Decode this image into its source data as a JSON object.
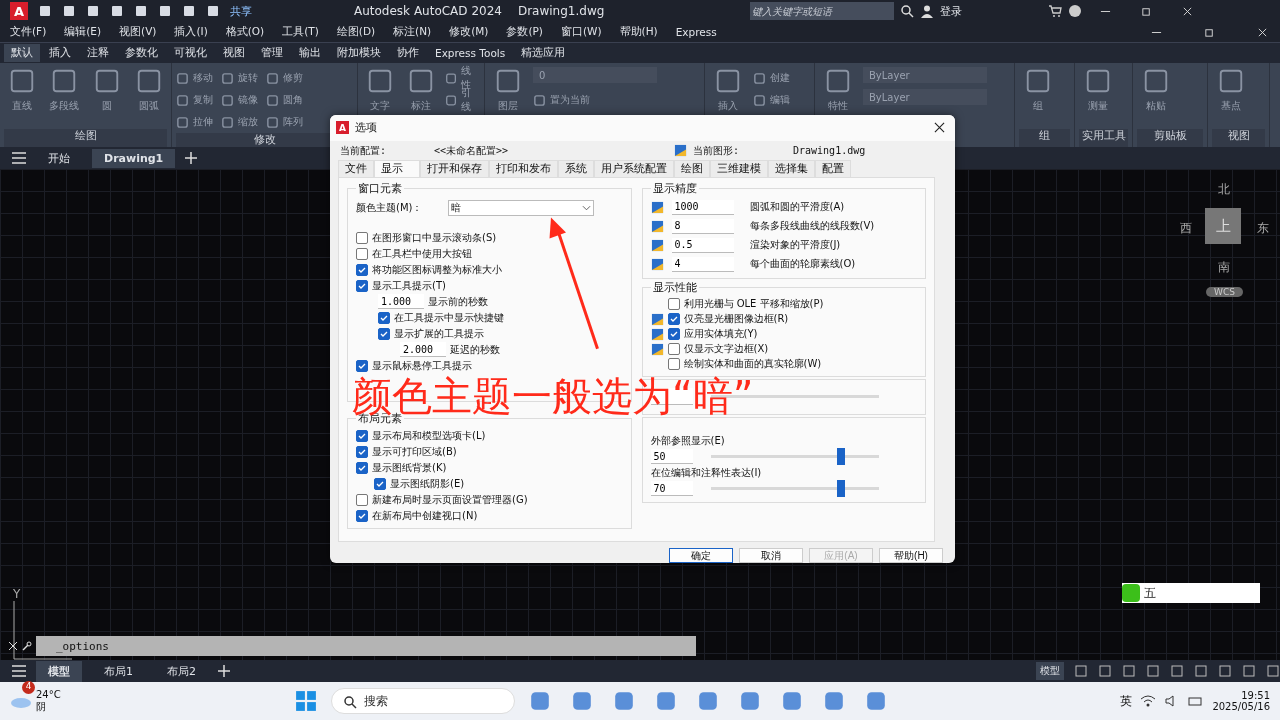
{
  "title_bar": {
    "logo_letter": "A",
    "share": "共享",
    "app_title": "Autodesk AutoCAD 2024",
    "file_name": "Drawing1.dwg",
    "search": {
      "placeholder": "键入关键字或短语"
    },
    "sign_in": "登录"
  },
  "menu_bar": [
    "文件(F)",
    "编辑(E)",
    "视图(V)",
    "插入(I)",
    "格式(O)",
    "工具(T)",
    "绘图(D)",
    "标注(N)",
    "修改(M)",
    "参数(P)",
    "窗口(W)",
    "帮助(H)",
    "Express"
  ],
  "ribbon": {
    "tabs": [
      {
        "label": "默认",
        "selected": true
      },
      {
        "label": "插入",
        "selected": false
      },
      {
        "label": "注释",
        "selected": false
      },
      {
        "label": "参数化",
        "selected": false
      },
      {
        "label": "可视化",
        "selected": false
      },
      {
        "label": "视图",
        "selected": false
      },
      {
        "label": "管理",
        "selected": false
      },
      {
        "label": "输出",
        "selected": false
      },
      {
        "label": "附加模块",
        "selected": false
      },
      {
        "label": "协作",
        "selected": false
      },
      {
        "label": "Express Tools",
        "selected": false
      },
      {
        "label": "精选应用",
        "selected": false
      }
    ],
    "panels": [
      {
        "title": "绘图",
        "tools": [
          {
            "kind": "large",
            "label": "直线"
          },
          {
            "kind": "large",
            "label": "多段线"
          },
          {
            "kind": "large",
            "label": "圆"
          },
          {
            "kind": "large",
            "label": "圆弧"
          }
        ]
      },
      {
        "title": "修改",
        "tools": [
          {
            "kind": "small",
            "label": "移动"
          },
          {
            "kind": "small",
            "label": "复制"
          },
          {
            "kind": "small",
            "label": "拉伸"
          },
          {
            "kind": "small",
            "label": "旋转"
          },
          {
            "kind": "small",
            "label": "镜像"
          },
          {
            "kind": "small",
            "label": "缩放"
          },
          {
            "kind": "small",
            "label": "修剪"
          },
          {
            "kind": "small",
            "label": "圆角"
          },
          {
            "kind": "small",
            "label": "阵列"
          }
        ]
      },
      {
        "tools": [
          {
            "kind": "large",
            "label": "文字"
          },
          {
            "kind": "large",
            "label": "标注"
          },
          {
            "kind": "small",
            "label": "线性"
          },
          {
            "kind": "small",
            "label": "引线"
          }
        ]
      },
      {
        "tools": [
          {
            "kind": "large",
            "label": "图层"
          },
          {
            "kind": "dropdown",
            "value": "0"
          },
          {
            "kind": "small",
            "label": "置为当前"
          }
        ]
      },
      {
        "tools": [
          {
            "kind": "large",
            "label": "插入"
          },
          {
            "kind": "small",
            "label": "创建"
          },
          {
            "kind": "small",
            "label": "编辑"
          }
        ]
      },
      {
        "tools": [
          {
            "kind": "large",
            "label": "特性"
          },
          {
            "kind": "dropdown",
            "value": "ByLayer"
          },
          {
            "kind": "dropdown",
            "value": "ByLayer"
          }
        ]
      },
      {
        "title": "组",
        "tools": [
          {
            "kind": "large",
            "label": "组"
          }
        ]
      },
      {
        "title": "实用工具",
        "tools": [
          {
            "kind": "large",
            "label": "测量"
          }
        ]
      },
      {
        "title": "剪贴板",
        "tools": [
          {
            "kind": "large",
            "label": "粘贴"
          }
        ]
      },
      {
        "title": "视图",
        "tools": [
          {
            "kind": "large",
            "label": "基点"
          }
        ]
      }
    ]
  },
  "doc_tabs": [
    {
      "label": "开始",
      "selected": false
    },
    {
      "label": "Drawing1",
      "selected": true
    }
  ],
  "viewcube": {
    "north": "北",
    "west": "西",
    "top": "上",
    "east": "东",
    "south": "南",
    "ucs": "WCS"
  },
  "ucs_axis": "Y",
  "command_line": {
    "value": "_options"
  },
  "ime_bar": {
    "mode": "五"
  },
  "layout_tabs": [
    {
      "label": "模型",
      "selected": true
    },
    {
      "label": "布局1",
      "selected": false
    },
    {
      "label": "布局2",
      "selected": false
    }
  ],
  "status_bar": {
    "space": "模型"
  },
  "dialog": {
    "logo_letter": "A",
    "title": "选项",
    "profile_label": "当前配置:",
    "profile": "<<未命名配置>>",
    "drawing_label": "当前图形:",
    "drawing": "Drawing1.dwg",
    "tabs": [
      {
        "label": "文件",
        "selected": false
      },
      {
        "label": "显示",
        "selected": true
      },
      {
        "label": "打开和保存",
        "selected": false
      },
      {
        "label": "打印和发布",
        "selected": false
      },
      {
        "label": "系统",
        "selected": false
      },
      {
        "label": "用户系统配置",
        "selected": false
      },
      {
        "label": "绘图",
        "selected": false
      },
      {
        "label": "三维建模",
        "selected": false
      },
      {
        "label": "选择集",
        "selected": false
      },
      {
        "label": "配置",
        "selected": false
      }
    ],
    "window_elements": {
      "title": "窗口元素",
      "theme_label": "颜色主题(M)：",
      "theme": "暗",
      "items": [
        {
          "kind": "checkbox",
          "label": "在图形窗口中显示滚动条(S)",
          "checked": false
        },
        {
          "kind": "checkbox",
          "label": "在工具栏中使用大按钮",
          "checked": false
        },
        {
          "kind": "checkbox",
          "label": "将功能区图标调整为标准大小",
          "checked": true
        },
        {
          "kind": "checkbox",
          "label": "显示工具提示(T)",
          "checked": true,
          "children": [
            {
              "kind": "number",
              "value": "1.000",
              "label": "显示前的秒数"
            },
            {
              "kind": "checkbox",
              "label": "在工具提示中显示快捷键",
              "checked": true
            },
            {
              "kind": "checkbox",
              "label": "显示扩展的工具提示",
              "checked": true,
              "children": [
                {
                  "kind": "number",
                  "value": "2.000",
                  "label": "延迟的秒数"
                }
              ]
            }
          ]
        },
        {
          "kind": "checkbox",
          "label": "显示鼠标悬停工具提示",
          "checked": true
        }
      ]
    },
    "layout_elements": {
      "title": "布局元素",
      "items": [
        {
          "kind": "checkbox",
          "label": "显示布局和模型选项卡(L)",
          "checked": true
        },
        {
          "kind": "checkbox",
          "label": "显示可打印区域(B)",
          "checked": true
        },
        {
          "kind": "checkbox",
          "label": "显示图纸背景(K)",
          "checked": true,
          "children": [
            {
              "kind": "checkbox",
              "label": "显示图纸阴影(E)",
              "checked": true
            }
          ]
        },
        {
          "kind": "checkbox",
          "label": "新建布局时显示页面设置管理器(G)",
          "checked": false
        },
        {
          "kind": "checkbox",
          "label": "在新布局中创建视口(N)",
          "checked": true
        }
      ]
    },
    "resolution": {
      "title": "显示精度",
      "rows": [
        {
          "value": "1000",
          "label": "圆弧和圆的平滑度(A)"
        },
        {
          "value": "8",
          "label": "每条多段线曲线的线段数(V)"
        },
        {
          "value": "0.5",
          "label": "渲染对象的平滑度(J)"
        },
        {
          "value": "4",
          "label": "每个曲面的轮廓素线(O)"
        }
      ]
    },
    "performance": {
      "title": "显示性能",
      "rows": [
        {
          "label": "利用光栅与 OLE 平移和缩放(P)",
          "checked": false,
          "drawing_icon": false
        },
        {
          "label": "仅亮显光栅图像边框(R)",
          "checked": true,
          "drawing_icon": true
        },
        {
          "label": "应用实体填充(Y)",
          "checked": true,
          "drawing_icon": true
        },
        {
          "label": "仅显示文字边框(X)",
          "checked": false,
          "drawing_icon": true
        },
        {
          "label": "绘制实体和曲面的真实轮廓(W)",
          "checked": false,
          "drawing_icon": false
        }
      ]
    },
    "fade": {
      "rows": [
        {
          "label": "外部参照显示(E)",
          "value": "50",
          "level": 0.75
        },
        {
          "label": "在位编辑和注释性表达(I)",
          "value": "70",
          "level": 0.75
        }
      ]
    },
    "buttons": [
      {
        "label": "确定",
        "kind": "default",
        "disabled": false
      },
      {
        "label": "取消",
        "kind": "normal",
        "disabled": false
      },
      {
        "label": "应用(A)",
        "kind": "normal",
        "disabled": true
      },
      {
        "label": "帮助(H)",
        "kind": "normal",
        "disabled": false
      }
    ]
  },
  "annotation": {
    "text": "颜色主题一般选为“暗”"
  },
  "taskbar": {
    "temperature": "24°C",
    "weather": "阴",
    "badge": "4",
    "search": {
      "placeholder": "搜索"
    },
    "input_method": "英",
    "time": "19:51",
    "date": "2025/05/16"
  }
}
